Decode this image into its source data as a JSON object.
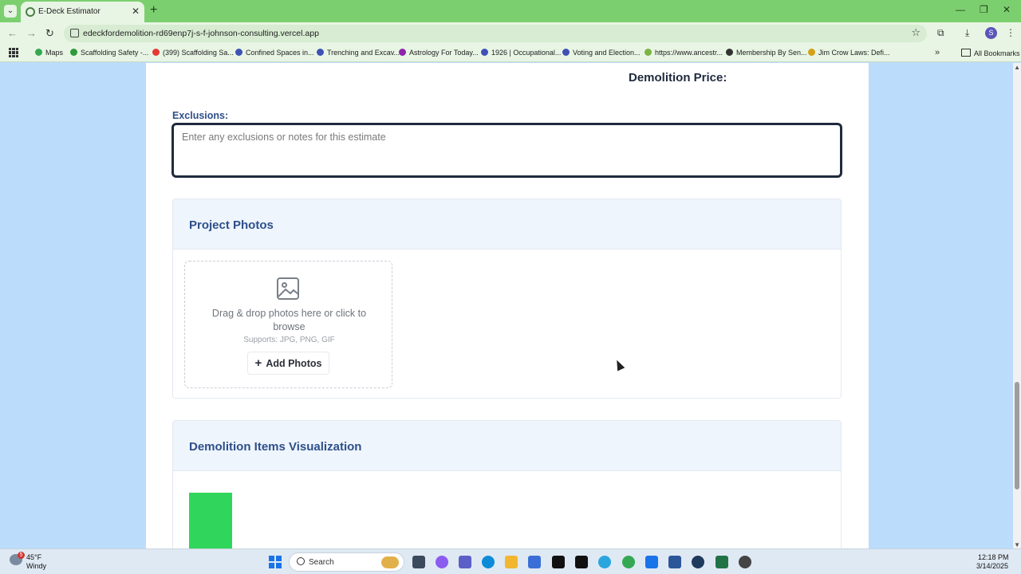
{
  "browser": {
    "tab_title": "E-Deck Estimator",
    "url": "edeckfordemolition-rd69enp7j-s-f-johnson-consulting.vercel.app",
    "new_tab": "+",
    "bookmarks": [
      {
        "label": "Maps",
        "color": "#34a853"
      },
      {
        "label": "Scaffolding Safety -...",
        "color": "#2e9a3a"
      },
      {
        "label": "(399) Scaffolding Sa...",
        "color": "#e53935"
      },
      {
        "label": "Confined Spaces in...",
        "color": "#3f51b5"
      },
      {
        "label": "Trenching and Excav...",
        "color": "#3f51b5"
      },
      {
        "label": "Astrology For Today...",
        "color": "#8e24aa"
      },
      {
        "label": "1926 | Occupational...",
        "color": "#3f51b5"
      },
      {
        "label": "Voting and Election...",
        "color": "#3f51b5"
      },
      {
        "label": "https://www.ancestr...",
        "color": "#7cb342"
      },
      {
        "label": "Membership By Sen...",
        "color": "#333333"
      },
      {
        "label": "Jim Crow Laws: Defi...",
        "color": "#d4a017"
      }
    ],
    "all_bookmarks": "All Bookmarks"
  },
  "page": {
    "price_label": "Demolition Price:",
    "exclusions_label": "Exclusions:",
    "exclusions_placeholder": "Enter any exclusions or notes for this estimate",
    "photos_title": "Project Photos",
    "dropzone_text": "Drag & drop photos here or click to browse",
    "dropzone_sub": "Supports: JPG, PNG, GIF",
    "add_photos_label": "Add Photos",
    "viz_title": "Demolition Items Visualization",
    "viz_bar_color": "#2fd65b"
  },
  "taskbar": {
    "weather_badge": "5",
    "temperature": "45°F",
    "condition": "Windy",
    "search_label": "Search",
    "time": "12:18 PM",
    "date": "3/14/2025"
  }
}
